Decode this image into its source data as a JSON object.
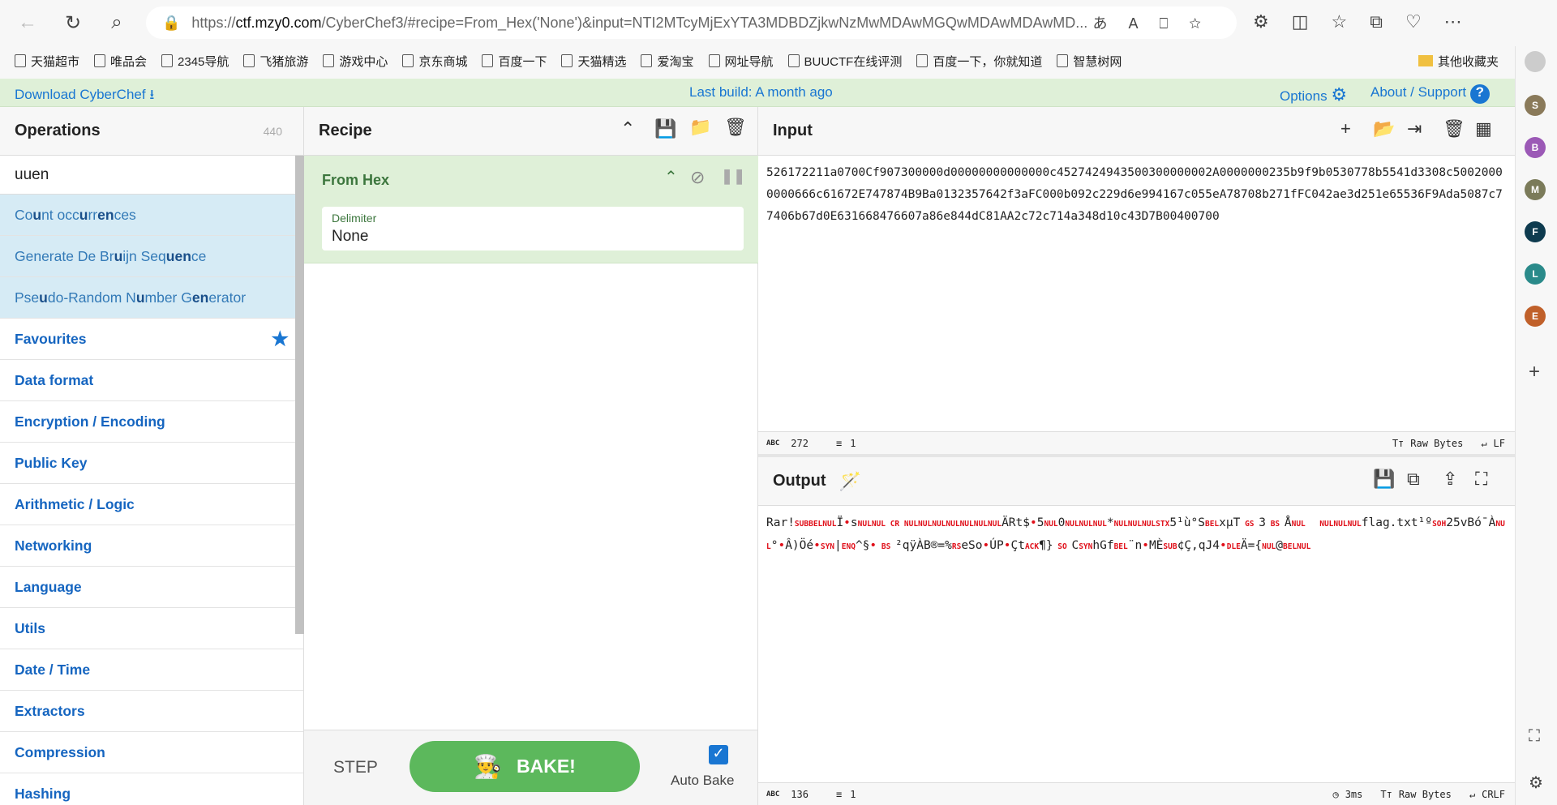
{
  "browser": {
    "url_host": "ctf.mzy0.com",
    "url_prefix": "https://",
    "url_rest": "/CyberChef3/#recipe=From_Hex('None')&input=NTI2MTcyMjExYTA3MDBDZjkwNzMwMDAwMGQwMDAwMDAwMD...",
    "bookmarks": [
      "天猫超市",
      "唯品会",
      "2345导航",
      "飞猪旅游",
      "游戏中心",
      "京东商城",
      "百度一下",
      "天猫精选",
      "爱淘宝",
      "网址导航",
      "BUUCTF在线评测",
      "百度一下，你就知道",
      "智慧树网"
    ],
    "other_bookmarks": "其他收藏夹",
    "profiles": [
      {
        "l": "S",
        "c": "#8a7a5a"
      },
      {
        "l": "B",
        "c": "#9b59b6"
      },
      {
        "l": "M",
        "c": "#7b7b5a"
      },
      {
        "l": "F",
        "c": "#0e3b4f"
      },
      {
        "l": "L",
        "c": "#2a8a8a"
      },
      {
        "l": "E",
        "c": "#c0602a"
      }
    ]
  },
  "banner": {
    "download": "Download CyberChef",
    "build": "Last build: A month ago",
    "options": "Options",
    "about": "About / Support"
  },
  "operations": {
    "title": "Operations",
    "count": "440",
    "search": "uuen",
    "results": [
      [
        "Co",
        "u",
        "nt occ",
        "u",
        "rr",
        "en",
        "ces"
      ],
      [
        "Generate De Br",
        "u",
        "ijn Seq",
        "uen",
        "ce"
      ],
      [
        "Pse",
        "u",
        "do-Random N",
        "u",
        "mber G",
        "en",
        "erator"
      ]
    ],
    "categories": [
      "Favourites",
      "Data format",
      "Encryption / Encoding",
      "Public Key",
      "Arithmetic / Logic",
      "Networking",
      "Language",
      "Utils",
      "Date / Time",
      "Extractors",
      "Compression",
      "Hashing"
    ]
  },
  "recipe": {
    "title": "Recipe",
    "op_name": "From Hex",
    "delimiter_label": "Delimiter",
    "delimiter_value": "None",
    "step": "STEP",
    "bake": "BAKE!",
    "auto_bake": "Auto Bake",
    "auto_bake_checked": true
  },
  "input": {
    "title": "Input",
    "value": "526172211a0700Cf907300000d00000000000000c4527424943500300000002A0000000235b9f9b0530778b5541d3308c50020000000666c61672E747874B9Ba0132357642f3aFC000b092c229d6e994167c055eA78708b271fFC042ae3d251e65536F9Ada5087c77406b67d0E631668476607a86e844dC81AA2c72c714a348d10c43D7B00400700",
    "chars": "272",
    "lines": "1",
    "encoding": "Raw Bytes",
    "eol": "LF"
  },
  "output": {
    "title": "Output",
    "chars": "136",
    "lines": "1",
    "time": "3ms",
    "encoding": "Raw Bytes",
    "eol": "CRLF",
    "segments": [
      "Rar!",
      {
        "c": "SUB"
      },
      {
        "c": "BEL"
      },
      {
        "c": "NUL"
      },
      "Ï",
      {
        "d": 1
      },
      "s",
      {
        "c": "NUL"
      },
      {
        "c": "NUL"
      },
      {
        "c": " CR "
      },
      {
        "c": "NUL"
      },
      {
        "c": "NUL"
      },
      {
        "c": "NUL"
      },
      {
        "c": "NUL"
      },
      {
        "c": "NUL"
      },
      {
        "c": "NUL"
      },
      {
        "c": "NUL"
      },
      "ÄRt$",
      {
        "d": 1
      },
      "5",
      {
        "c": "NUL"
      },
      "0",
      {
        "c": "NUL"
      },
      {
        "c": "NUL"
      },
      {
        "c": "NUL"
      },
      "*",
      {
        "c": "NUL"
      },
      {
        "c": "NUL"
      },
      {
        "c": "NUL"
      },
      {
        "c": "STX"
      },
      "5¹ù°S",
      {
        "c": "BEL"
      },
      "xµT",
      {
        "c": " GS "
      },
      "3",
      {
        "c": " BS "
      },
      "Å",
      {
        "c": "NUL"
      },
      "  ",
      {
        "c": "NUL"
      },
      {
        "c": "NUL"
      },
      {
        "c": "NUL"
      },
      "flag.txt¹º",
      {
        "c": "SOH"
      },
      "25vBó¯À",
      {
        "c": "NUL"
      },
      "°",
      {
        "d": 1
      },
      "Â)Öé",
      {
        "d": 1
      },
      {
        "c": "SYN"
      },
      "|",
      {
        "c": "ENQ"
      },
      "^§",
      {
        "d": 1
      },
      {
        "c": " BS "
      },
      "²qÿÀB®=%",
      {
        "c": "RS"
      },
      "eSo",
      {
        "d": 1
      },
      "ÚP",
      {
        "d": 1
      },
      "Çt",
      {
        "c": "ACK"
      },
      "¶}",
      {
        "c": " SO "
      },
      "C",
      {
        "c": "SYN"
      },
      "hGf",
      {
        "c": "BEL"
      },
      "¨n",
      {
        "d": 1
      },
      "MÈ",
      {
        "c": "SUB"
      },
      "¢Ç,qJ4",
      {
        "d": 1
      },
      {
        "c": "DLE"
      },
      "Ä={",
      {
        "c": "NUL"
      },
      "@",
      {
        "c": "BEL"
      },
      {
        "c": "NUL"
      }
    ]
  },
  "colors": {
    "banner": "#dff0d8",
    "accent": "#1976d2",
    "bake": "#5cb85c",
    "control": "#e0101a"
  }
}
